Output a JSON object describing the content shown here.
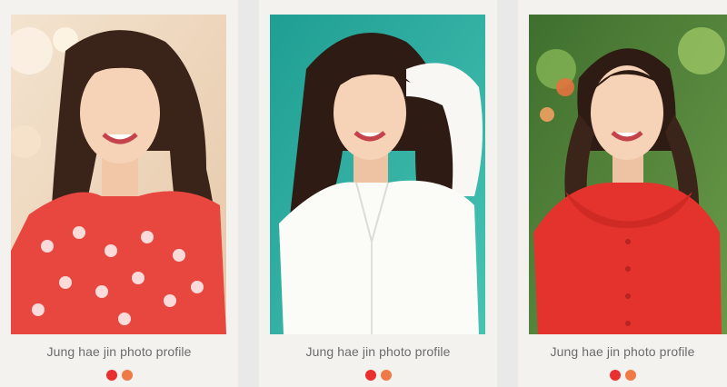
{
  "colors": {
    "background": "#e9e9e9",
    "card": "#f3f2ef",
    "caption": "#6b6b6b",
    "dot_primary": "#e9302f",
    "dot_secondary": "#f07a45"
  },
  "cards": [
    {
      "caption": "Jung hae jin photo profile",
      "photo_icon": "portrait-photo",
      "dots": [
        {
          "color": "#e9302f"
        },
        {
          "color": "#f07a45"
        }
      ]
    },
    {
      "caption": "Jung hae jin photo profile",
      "photo_icon": "portrait-photo",
      "dots": [
        {
          "color": "#e9302f"
        },
        {
          "color": "#f07a45"
        }
      ]
    },
    {
      "caption": "Jung hae jin photo profile",
      "photo_icon": "portrait-photo",
      "dots": [
        {
          "color": "#e9302f"
        },
        {
          "color": "#f07a45"
        }
      ]
    }
  ]
}
